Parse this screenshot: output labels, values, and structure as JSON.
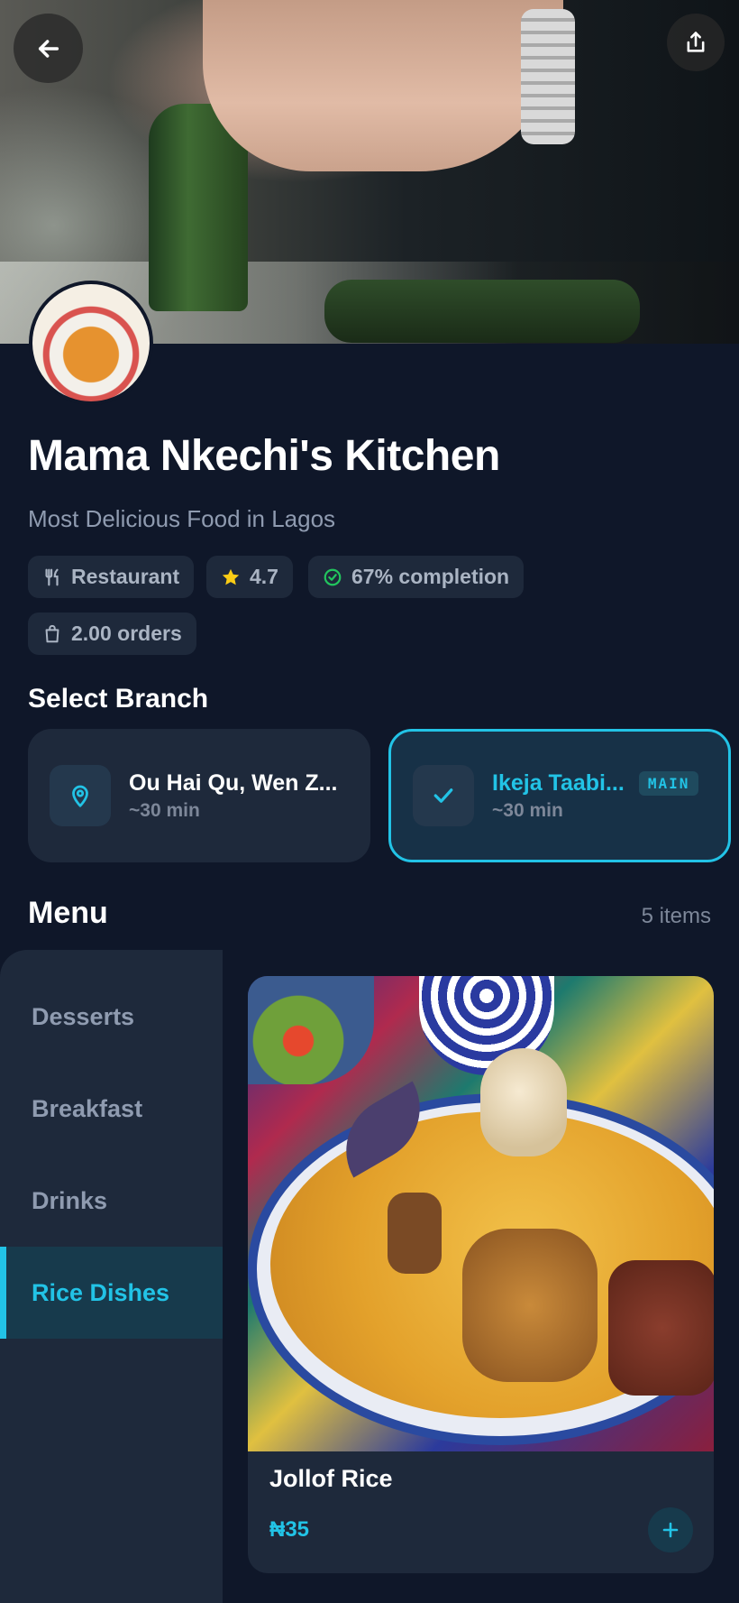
{
  "restaurant": {
    "name": "Mama Nkechi's Kitchen",
    "tagline": "Most Delicious Food in Lagos"
  },
  "chips": {
    "type": "Restaurant",
    "rating": "4.7",
    "completion": "67% completion",
    "orders": "2.00 orders"
  },
  "branch": {
    "title": "Select Branch",
    "items": [
      {
        "name": "Ou Hai Qu, Wen Z...",
        "time": "~30 min",
        "icon": "map-pin-icon",
        "selected": false
      },
      {
        "name": "Ikeja Taabi...",
        "time": "~30 min",
        "icon": "check-icon",
        "selected": true,
        "badge": "MAIN"
      }
    ]
  },
  "menu": {
    "title": "Menu",
    "count": "5 items",
    "categories": [
      {
        "label": "Desserts",
        "active": false
      },
      {
        "label": "Breakfast",
        "active": false
      },
      {
        "label": "Drinks",
        "active": false
      },
      {
        "label": "Rice Dishes",
        "active": true
      }
    ],
    "items": [
      {
        "name": "Jollof Rice",
        "price": "₦35"
      }
    ]
  },
  "colors": {
    "background": "#0f1729",
    "card": "#1e293b",
    "accent": "#22c3e6",
    "star": "#facc15",
    "success": "#22c55e"
  }
}
